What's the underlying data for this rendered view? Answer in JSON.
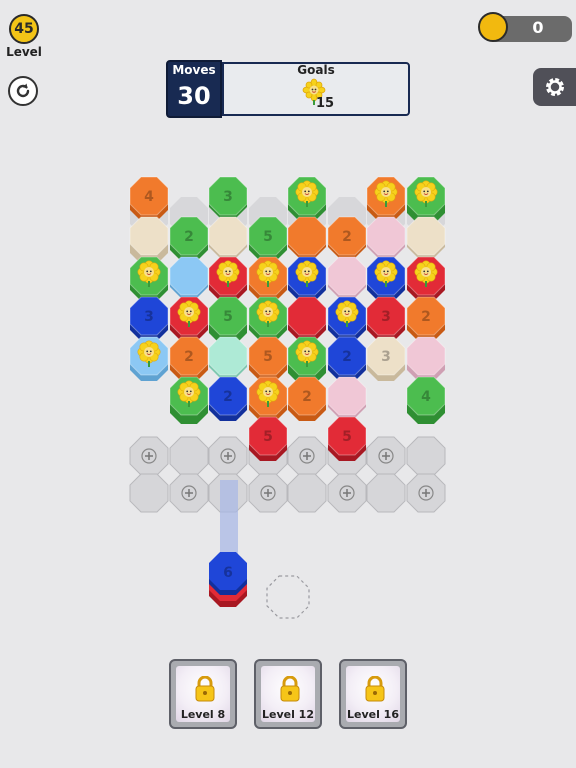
{
  "hud": {
    "level_number": "45",
    "level_label": "Level",
    "coins": "0",
    "moves_label": "Moves",
    "moves_value": "30",
    "goals_label": "Goals",
    "goal_count": "15",
    "goal_icon": "sunflower-icon"
  },
  "colors": {
    "orange": "#f17a2c",
    "green": "#4cbd4f",
    "red": "#e22b37",
    "blue": "#1f46d8",
    "beige": "#ede0c8",
    "lightblue": "#8cc8f4",
    "pink": "#f0c7d6",
    "mint": "#aeead6",
    "empty": "#c8c8cc"
  },
  "rewards": [
    {
      "label": "Level 8"
    },
    {
      "label": "Level 12"
    },
    {
      "label": "Level 16"
    }
  ]
}
